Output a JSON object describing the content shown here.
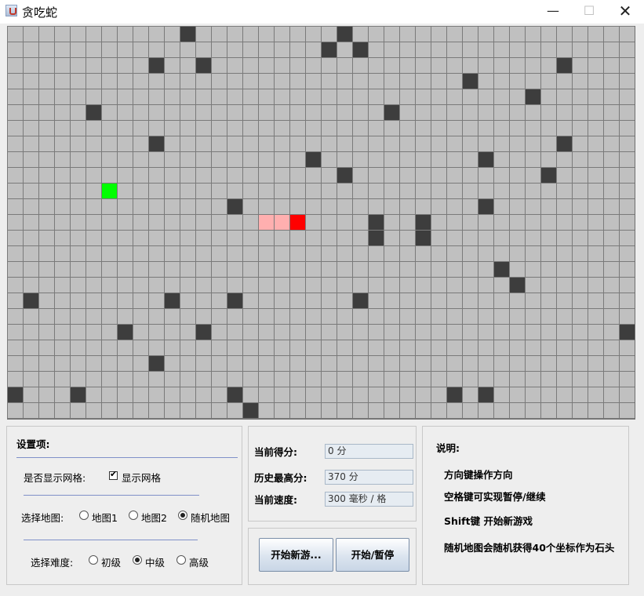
{
  "window": {
    "title": "贪吃蛇",
    "minimize": "—",
    "maximize": "☐",
    "close": "✕"
  },
  "board": {
    "columns": 40,
    "rows": 25,
    "colors": {
      "background": "#c0c0c0",
      "grid": "#7a7a7a",
      "rock": "#3d3d3d",
      "food": "#00ff00",
      "snake_head": "#ff0000",
      "snake_body": "#ffafaf"
    },
    "rocks": [
      [
        11,
        0
      ],
      [
        21,
        0
      ],
      [
        20,
        1
      ],
      [
        22,
        1
      ],
      [
        9,
        2
      ],
      [
        12,
        2
      ],
      [
        35,
        2
      ],
      [
        29,
        3
      ],
      [
        33,
        4
      ],
      [
        5,
        5
      ],
      [
        24,
        5
      ],
      [
        9,
        7
      ],
      [
        35,
        7
      ],
      [
        19,
        8
      ],
      [
        30,
        8
      ],
      [
        21,
        9
      ],
      [
        34,
        9
      ],
      [
        14,
        11
      ],
      [
        30,
        11
      ],
      [
        23,
        12
      ],
      [
        26,
        12
      ],
      [
        23,
        13
      ],
      [
        26,
        13
      ],
      [
        31,
        15
      ],
      [
        32,
        16
      ],
      [
        1,
        17
      ],
      [
        10,
        17
      ],
      [
        14,
        17
      ],
      [
        22,
        17
      ],
      [
        7,
        19
      ],
      [
        12,
        19
      ],
      [
        39,
        19
      ],
      [
        9,
        21
      ],
      [
        0,
        23
      ],
      [
        4,
        23
      ],
      [
        14,
        23
      ],
      [
        28,
        23
      ],
      [
        30,
        23
      ],
      [
        15,
        24
      ]
    ],
    "food": [
      6,
      10
    ],
    "snake": {
      "head": [
        18,
        12
      ],
      "body": [
        [
          16,
          12
        ],
        [
          17,
          12
        ]
      ]
    }
  },
  "settings": {
    "heading": "设置项:",
    "grid_label": "是否显示网格:",
    "grid_checkbox_label": "显示网格",
    "grid_checked": true,
    "map_label": "选择地图:",
    "maps": [
      "地图1",
      "地图2",
      "随机地图"
    ],
    "selected_map": "随机地图",
    "difficulty_label": "选择难度:",
    "difficulties": [
      "初级",
      "中级",
      "高级"
    ],
    "selected_difficulty": "中级"
  },
  "score": {
    "current_label": "当前得分:",
    "current_value": "0 分",
    "best_label": "历史最高分:",
    "best_value": "370 分",
    "speed_label": "当前速度:",
    "speed_value": "300 毫秒 / 格"
  },
  "buttons": {
    "new_game": "开始新游...",
    "pause": "开始/暂停"
  },
  "help": {
    "heading": "说明:",
    "lines": [
      "方向键操作方向",
      "空格键可实现暂停/继续",
      "Shift键 开始新游戏",
      "随机地图会随机获得40个坐标作为石头"
    ]
  }
}
